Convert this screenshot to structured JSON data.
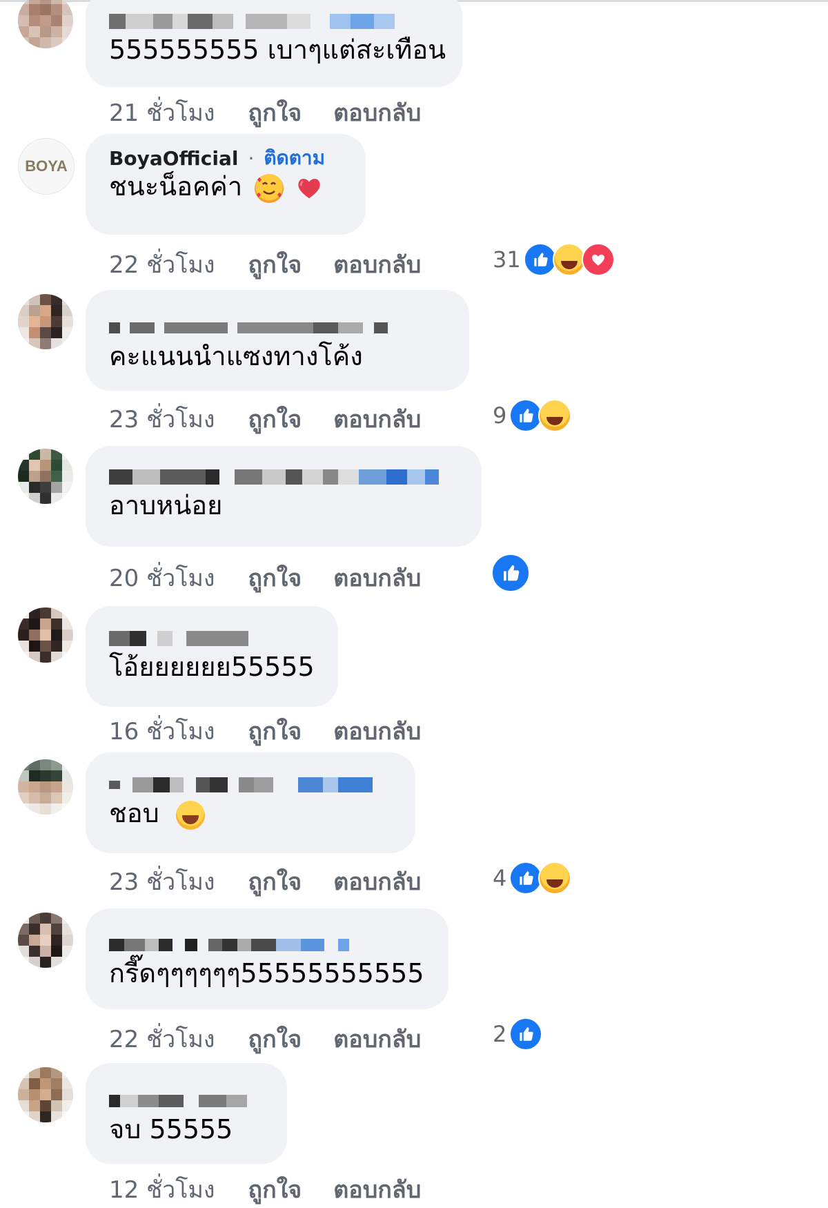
{
  "comments": [
    {
      "author_label": "",
      "author": "",
      "follow_label": "",
      "text": "555555555 เบาๆแต่สะเทือน",
      "time": "21 ชั่วโมง",
      "like_label": "ถูกใจ",
      "reply_label": "ตอบกลับ",
      "reaction_count": "",
      "reactions": []
    },
    {
      "author": "BoyaOfficial",
      "follow_label": "ติดตาม",
      "avatar_text": "BOYA",
      "text": "ชนะน็อคค่า",
      "emojis": [
        "smiling-face-with-hearts",
        "heart"
      ],
      "time": "22 ชั่วโมง",
      "like_label": "ถูกใจ",
      "reply_label": "ตอบกลับ",
      "reaction_count": "31",
      "reactions": [
        "like",
        "haha",
        "love"
      ]
    },
    {
      "author": "",
      "text": "คะแนนนำแซงทางโค้ง",
      "time": "23 ชั่วโมง",
      "like_label": "ถูกใจ",
      "reply_label": "ตอบกลับ",
      "reaction_count": "9",
      "reactions": [
        "like",
        "haha"
      ]
    },
    {
      "author": "",
      "text": "อาบหน่อย",
      "time": "20 ชั่วโมง",
      "like_label": "ถูกใจ",
      "reply_label": "ตอบกลับ",
      "reaction_count": "",
      "reactions": [
        "like"
      ]
    },
    {
      "author": "",
      "text": "โอ้ยยยยยย55555",
      "time": "16 ชั่วโมง",
      "like_label": "ถูกใจ",
      "reply_label": "ตอบกลับ",
      "reaction_count": "",
      "reactions": []
    },
    {
      "author": "",
      "text": "ชอบ",
      "emojis": [
        "laughing"
      ],
      "time": "23 ชั่วโมง",
      "like_label": "ถูกใจ",
      "reply_label": "ตอบกลับ",
      "reaction_count": "4",
      "reactions": [
        "like",
        "haha"
      ]
    },
    {
      "author": "",
      "text": "กรี๊ดๆๆๆๆๆๆ55555555555",
      "time": "22 ชั่วโมง",
      "like_label": "ถูกใจ",
      "reply_label": "ตอบกลับ",
      "reaction_count": "2",
      "reactions": [
        "like"
      ]
    },
    {
      "author": "",
      "text": "จบ 55555",
      "time": "12 ชั่วโมง",
      "like_label": "ถูกใจ",
      "reply_label": "ตอบกลับ",
      "reaction_count": "",
      "reactions": []
    }
  ],
  "colors": {
    "bubble": "#f0f2f5",
    "meta_text": "#606770",
    "link_blue": "#216fdb",
    "like_blue": "#1877f2",
    "love_red": "#f33e58",
    "haha_yellow": "#ffd34e"
  }
}
